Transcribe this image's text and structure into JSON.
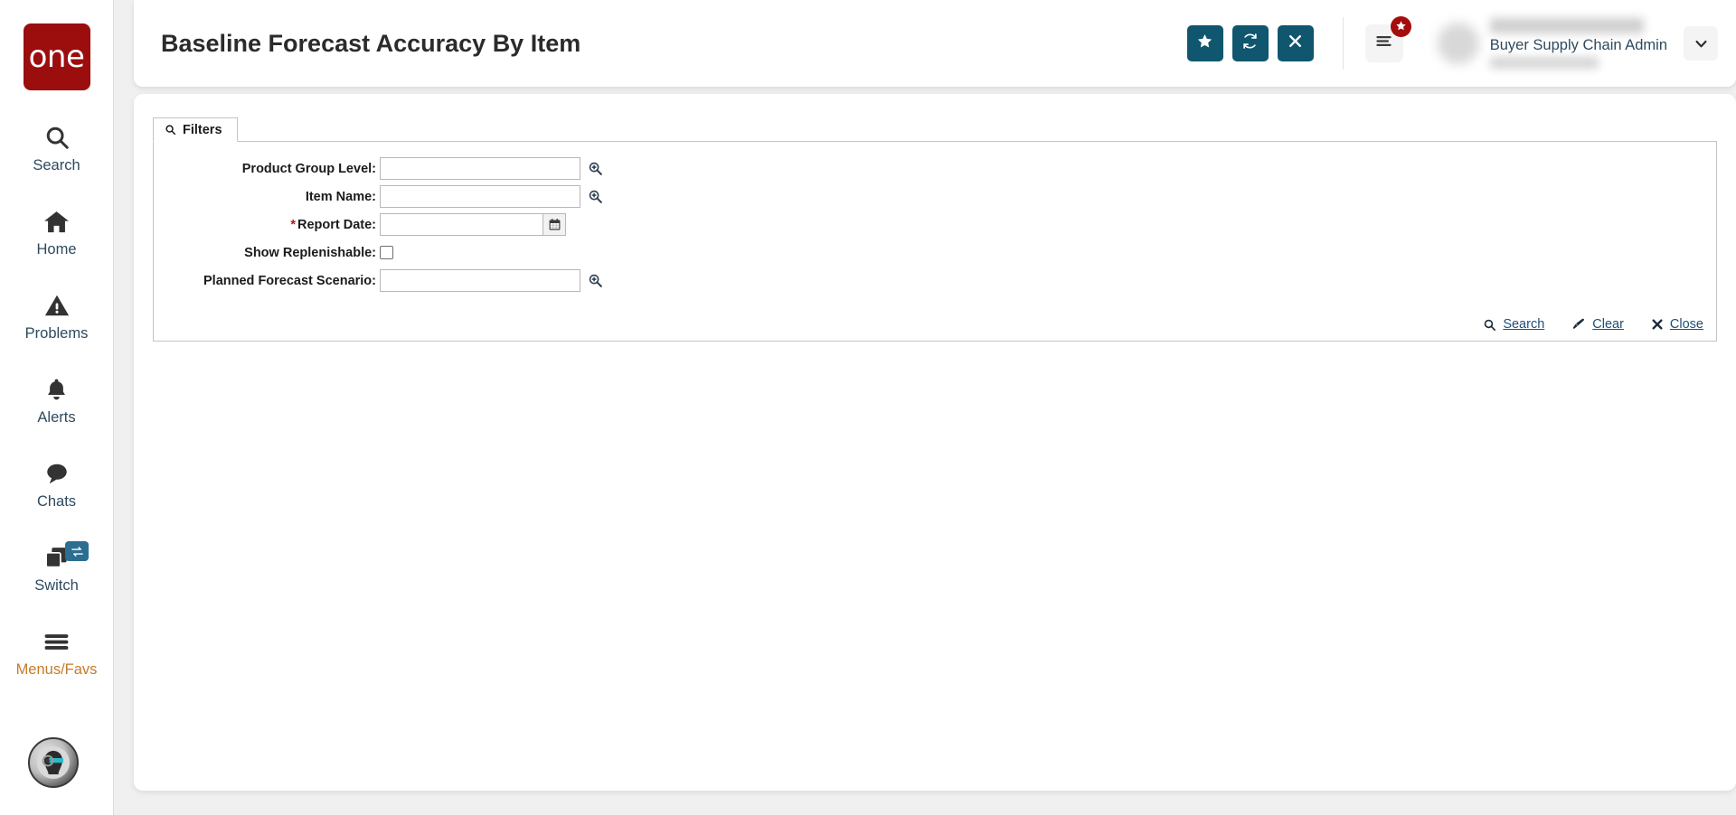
{
  "brand": {
    "logo_text": "one",
    "logo_color": "#9c0d0d"
  },
  "sidebar": {
    "items": [
      {
        "label": "Search",
        "icon": "search-icon"
      },
      {
        "label": "Home",
        "icon": "home-icon"
      },
      {
        "label": "Problems",
        "icon": "warning-triangle-icon"
      },
      {
        "label": "Alerts",
        "icon": "bell-icon"
      },
      {
        "label": "Chats",
        "icon": "chat-bubble-icon"
      },
      {
        "label": "Switch",
        "icon": "switch-windows-icon",
        "badge_icon": "swap-arrows-icon"
      },
      {
        "label": "Menus/Favs",
        "icon": "hamburger-icon"
      }
    ],
    "assistant_avatar": "robot-assistant-avatar"
  },
  "header": {
    "title": "Baseline Forecast Accuracy By Item",
    "accent_color": "#0f566e",
    "buttons": [
      {
        "name": "favorite-button",
        "icon": "star-icon"
      },
      {
        "name": "refresh-button",
        "icon": "refresh-icon"
      },
      {
        "name": "close-button",
        "icon": "close-x-icon"
      }
    ],
    "menu_favs_button": {
      "icon": "hamburger-icon",
      "badge_icon": "star-icon",
      "badge_color": "#a50d0d"
    },
    "user": {
      "name": "",
      "role": "Buyer Supply Chain Admin",
      "org": "",
      "caret_icon": "chevron-down-icon"
    }
  },
  "filters": {
    "tab_label": "Filters",
    "tab_icon": "search-icon",
    "fields": [
      {
        "label": "Product Group Level:",
        "value": "",
        "placeholder": "",
        "required": false,
        "control": "lookup"
      },
      {
        "label": "Item Name:",
        "value": "",
        "placeholder": "",
        "required": false,
        "control": "lookup"
      },
      {
        "label": "Report Date:",
        "value": "",
        "placeholder": "",
        "required": true,
        "control": "date"
      },
      {
        "label": "Show Replenishable:",
        "value": "",
        "placeholder": "",
        "required": false,
        "control": "checkbox",
        "checked": false
      },
      {
        "label": "Planned Forecast Scenario:",
        "value": "",
        "placeholder": "",
        "required": false,
        "control": "lookup"
      }
    ],
    "actions": [
      {
        "label": "Search",
        "icon": "search-icon"
      },
      {
        "label": "Clear",
        "icon": "eraser-icon"
      },
      {
        "label": "Close",
        "icon": "close-x-icon"
      }
    ]
  }
}
